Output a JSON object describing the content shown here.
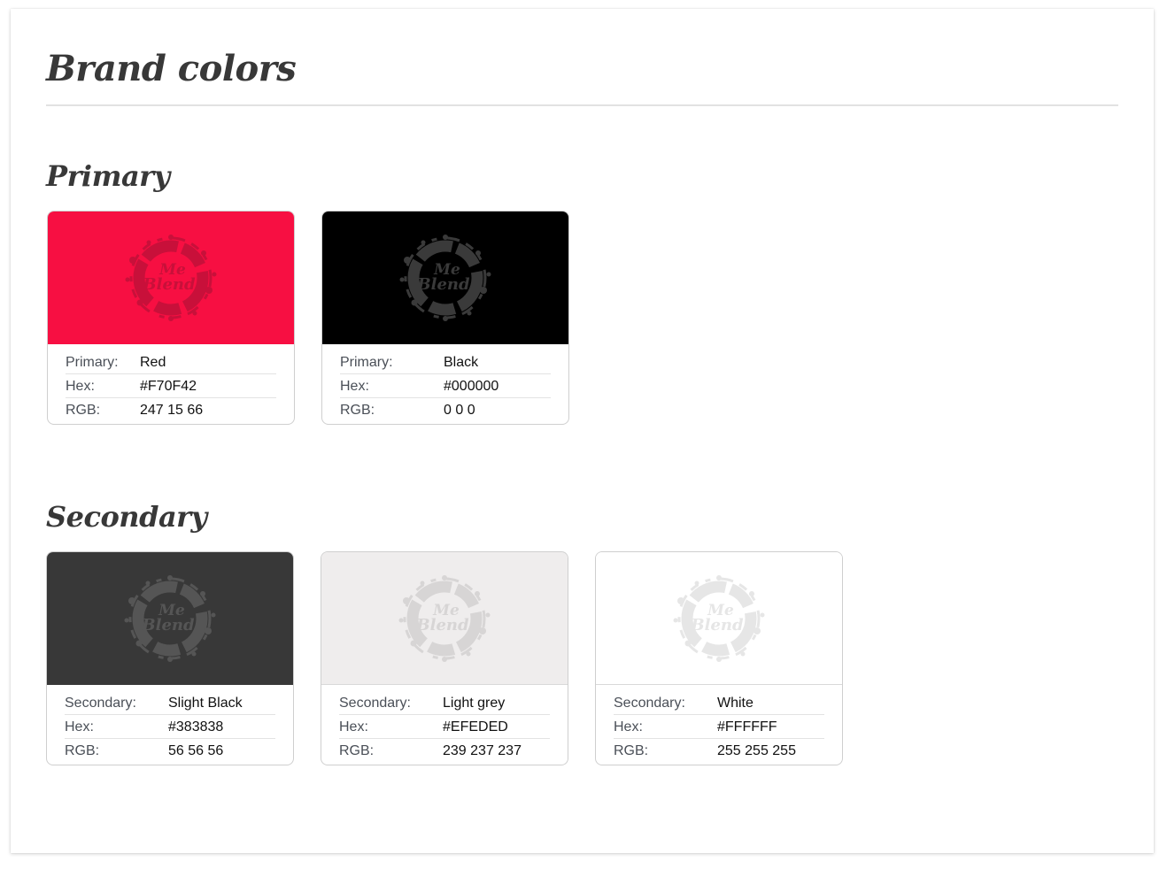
{
  "page": {
    "title": "Brand colors"
  },
  "primary": {
    "heading": "Primary",
    "cards": [
      {
        "label": "Primary:",
        "name": "Red",
        "hex_label": "Hex:",
        "hex": "#F70F42",
        "rgb_label": "RGB:",
        "rgb": "247 15 66",
        "swatch": "#F70F42",
        "logo_color": "#c8103a"
      },
      {
        "label": "Primary:",
        "name": "Black",
        "hex_label": "Hex:",
        "hex": "#000000",
        "rgb_label": "RGB:",
        "rgb": "0 0 0",
        "swatch": "#000000",
        "logo_color": "#3a3a3a"
      }
    ]
  },
  "secondary": {
    "heading": "Secondary",
    "cards": [
      {
        "label": "Secondary:",
        "name": "Slight Black",
        "hex_label": "Hex:",
        "hex": "#383838",
        "rgb_label": "RGB:",
        "rgb": "56 56 56",
        "swatch": "#383838",
        "logo_color": "#555555"
      },
      {
        "label": "Secondary:",
        "name": "Light grey",
        "hex_label": "Hex:",
        "hex": "#EFEDED",
        "rgb_label": "RGB:",
        "rgb": "239 237 237",
        "swatch": "#EFEDED",
        "logo_color": "#d7d5d5"
      },
      {
        "label": "Secondary:",
        "name": "White",
        "hex_label": "Hex:",
        "hex": "#FFFFFF",
        "rgb_label": "RGB:",
        "rgb": "255 255 255",
        "swatch": "#FFFFFF",
        "logo_color": "#e6e6e6"
      }
    ]
  },
  "logo": {
    "line1": "Me",
    "line2": "Blend",
    "icon": "splash-logo-icon"
  }
}
